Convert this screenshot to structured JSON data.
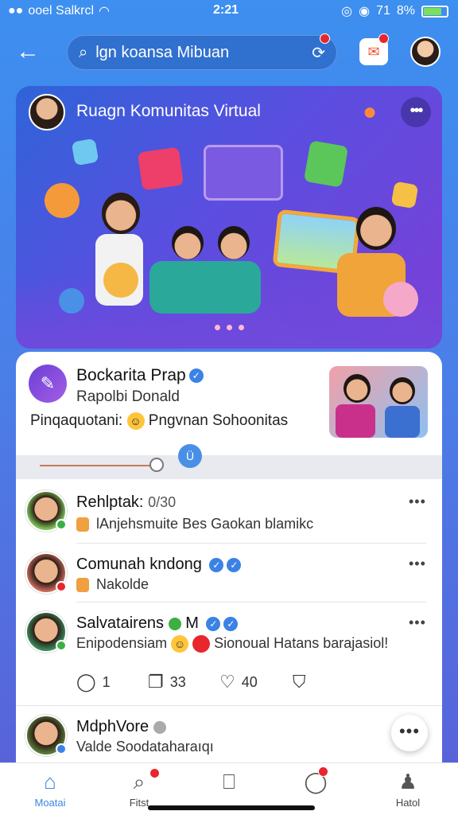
{
  "status_bar": {
    "carrier": "ooel Salkrcl",
    "time": "2:21",
    "signal": "71",
    "battery": "8%",
    "battery_level": 0.8
  },
  "top_bar": {
    "search_text": "lgn koansa Mibuan"
  },
  "hero": {
    "title": "Ruagn Komunitas Virtual"
  },
  "featured_post": {
    "name": "Bockarita Prap",
    "subtitle": "Rapolbi Donald",
    "desc_before": "Pinqaquotani:",
    "desc_after": "Pngvnan Sohoonitas",
    "progress": 0.35
  },
  "feed": {
    "posts": [
      {
        "name": "Rehlptak:",
        "time": "0/30",
        "text": "lAnjehsmuite Bes Gaokan blamikc",
        "status_color": "#3cb043"
      },
      {
        "name": "Comunah kndong",
        "text": "Nakolde",
        "status_color": "#e8262e"
      },
      {
        "name": "Salvatairens",
        "name_suffix": "M",
        "text_before": "Enipodensiam",
        "text_after": "Sionoual Hatans barajasiol!",
        "status_color": "#3cb043",
        "actions": {
          "comments": "1",
          "shares": "33",
          "likes": "40"
        }
      },
      {
        "name": "MdphVore",
        "text": "Valde Soodataharaıqı",
        "status_color": "#3b82e6"
      }
    ]
  },
  "bottom_nav": {
    "items": [
      {
        "label": "Moatai",
        "icon": "home-icon"
      },
      {
        "label": "Fitst",
        "icon": "search-bell-icon"
      },
      {
        "label": "",
        "icon": "bookmark-icon"
      },
      {
        "label": "",
        "icon": "chat-icon"
      },
      {
        "label": "Hatol",
        "icon": "profile-icon"
      }
    ]
  },
  "colors": {
    "accent": "#3a86e4",
    "badge_red": "#e8262e",
    "verified_blue": "#3b82e6"
  }
}
